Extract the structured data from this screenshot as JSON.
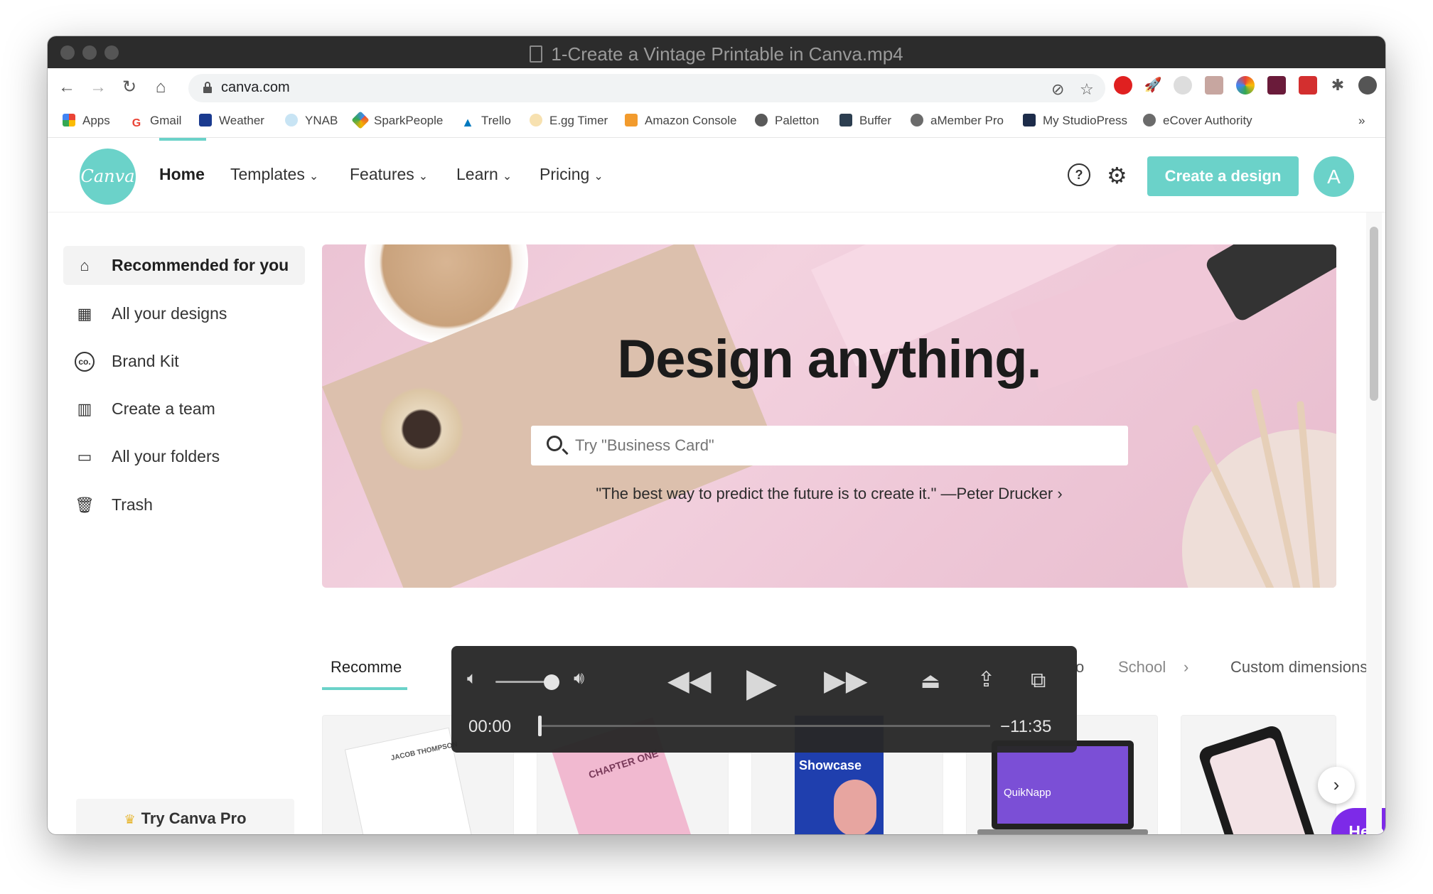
{
  "window": {
    "title": "1-Create a Vintage Printable in Canva.mp4"
  },
  "browser": {
    "url": "canva.com",
    "bookmarks": [
      {
        "label": "Apps",
        "color": "#4285f4"
      },
      {
        "label": "Gmail",
        "color": "#ea4335"
      },
      {
        "label": "Weather",
        "color": "#1a3a8f"
      },
      {
        "label": "YNAB",
        "color": "#85c3e9"
      },
      {
        "label": "SparkPeople",
        "color": "#e84b3c"
      },
      {
        "label": "Trello",
        "color": "#0079bf"
      },
      {
        "label": "E.gg Timer",
        "color": "#f2b233"
      },
      {
        "label": "Amazon Console",
        "color": "#f29b2d"
      },
      {
        "label": "Paletton",
        "color": "#5a5a5a"
      },
      {
        "label": "Buffer",
        "color": "#2c3e50"
      },
      {
        "label": "aMember Pro",
        "color": "#6b6b6b"
      },
      {
        "label": "My StudioPress",
        "color": "#1d2c4a"
      },
      {
        "label": "eCover Authority",
        "color": "#6b6b6b"
      }
    ],
    "more_bookmarks": "»"
  },
  "header": {
    "logo_text": "Canva",
    "nav": [
      {
        "label": "Home"
      },
      {
        "label": "Templates"
      },
      {
        "label": "Features"
      },
      {
        "label": "Learn"
      },
      {
        "label": "Pricing"
      }
    ],
    "help_glyph": "?",
    "create_label": "Create a design",
    "avatar_letter": "A",
    "accent": "#6bd2c9"
  },
  "sidebar": {
    "items": [
      {
        "label": "Recommended for you",
        "icon": "home-icon"
      },
      {
        "label": "All your designs",
        "icon": "grid-icon"
      },
      {
        "label": "Brand Kit",
        "icon": "brand-kit-icon"
      },
      {
        "label": "Create a team",
        "icon": "team-icon"
      },
      {
        "label": "All your folders",
        "icon": "folder-icon"
      },
      {
        "label": "Trash",
        "icon": "trash-icon"
      }
    ],
    "try_pro": "Try Canva Pro"
  },
  "hero": {
    "title": "Design anything.",
    "search_placeholder": "Try \"Business Card\"",
    "quote": "\"The best way to predict the future is to create it.\" —Peter Drucker ›"
  },
  "tabs": {
    "items": [
      "Recomme",
      "o",
      "School",
      "Custom dimensions"
    ],
    "chevron": "›"
  },
  "cards": [
    {
      "label": "JACOB THOMPSON",
      "bg": "#f2f2f2"
    },
    {
      "label": "CHAPTER ONE",
      "bg": "#f0e9ec"
    },
    {
      "label": "Showcase",
      "bg": "#ece9e4"
    },
    {
      "label": "QuikNapp",
      "bg": "#ebebeb"
    },
    {
      "label": "",
      "bg": "#f0f0f0"
    }
  ],
  "help_button": "Help ?",
  "player": {
    "current_time": "00:00",
    "remaining_time": "−11:35",
    "volume": 0.9,
    "progress": 0.0
  }
}
